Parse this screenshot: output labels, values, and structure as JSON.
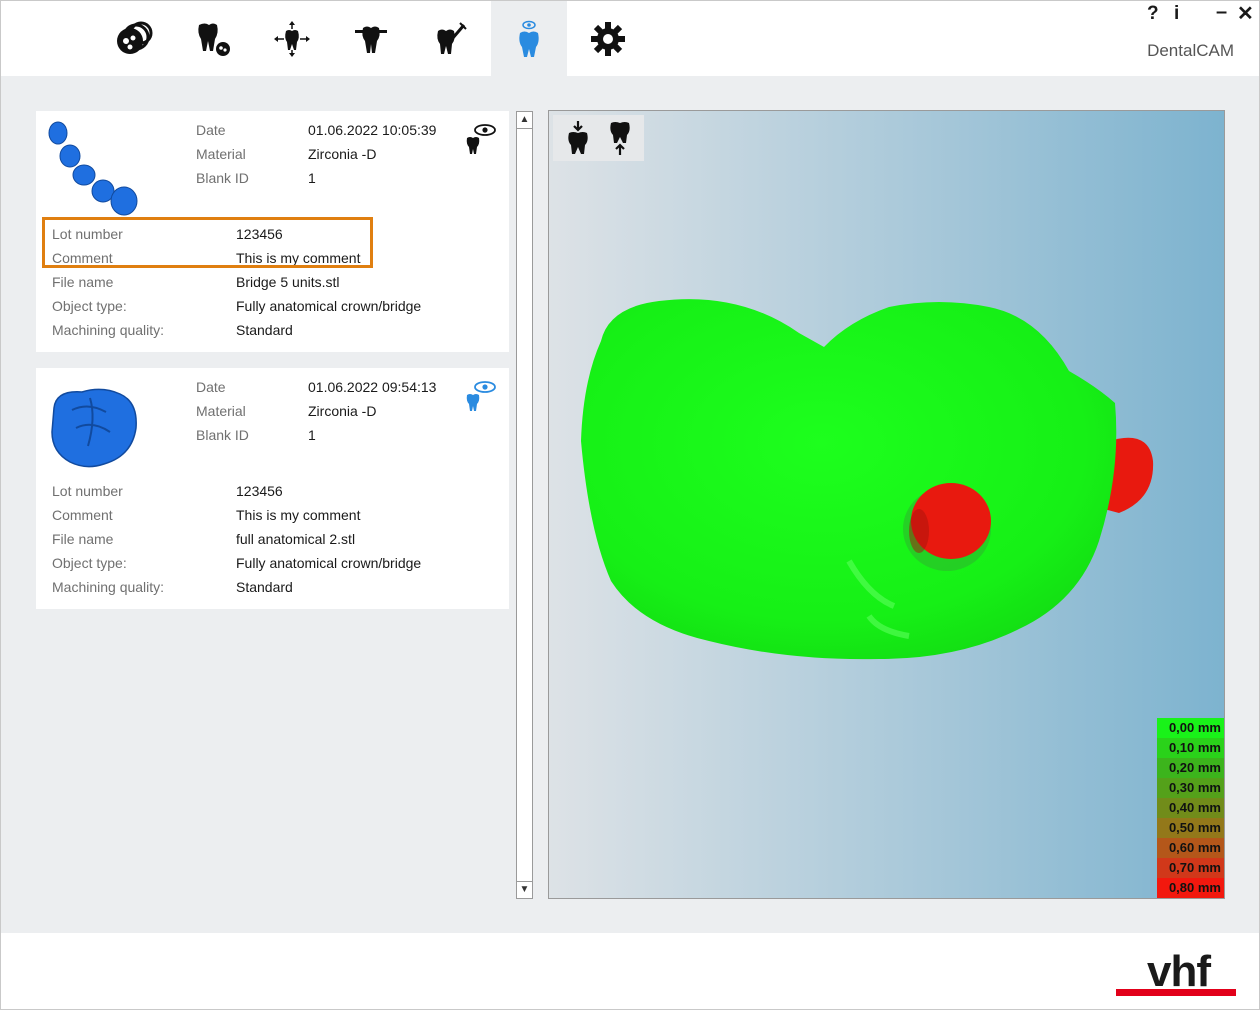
{
  "app": {
    "title": "DentalCAM",
    "help": "?",
    "info": "i",
    "minimize": "–",
    "close": "✕"
  },
  "toolbar": [
    {
      "name": "blank-magazine-icon"
    },
    {
      "name": "tooth-blank-icon"
    },
    {
      "name": "tooth-positioning-icon"
    },
    {
      "name": "tooth-holder-icon"
    },
    {
      "name": "tooth-tool-icon"
    },
    {
      "name": "tooth-preview-icon",
      "active": true
    },
    {
      "name": "settings-gear-icon"
    }
  ],
  "cards": [
    {
      "date_label": "Date",
      "date": "01.06.2022 10:05:39",
      "material_label": "Material",
      "material": "Zirconia -D",
      "blank_label": "Blank ID",
      "blank": "1",
      "lot_label": "Lot number",
      "lot": "123456",
      "comment_label": "Comment",
      "comment": "This is my comment",
      "file_label": "File name",
      "file": "Bridge 5 units.stl",
      "type_label": "Object type:",
      "type": "Fully anatomical crown/bridge",
      "quality_label": "Machining quality:",
      "quality": "Standard",
      "eye_color": "#111111"
    },
    {
      "date_label": "Date",
      "date": "01.06.2022 09:54:13",
      "material_label": "Material",
      "material": "Zirconia -D",
      "blank_label": "Blank ID",
      "blank": "1",
      "lot_label": "Lot number",
      "lot": "123456",
      "comment_label": "Comment",
      "comment": "This is my comment",
      "file_label": "File name",
      "file": "full anatomical 2.stl",
      "type_label": "Object type:",
      "type": "Fully anatomical crown/bridge",
      "quality_label": "Machining quality:",
      "quality": "Standard",
      "eye_color": "#2a8be0"
    }
  ],
  "scroll": {
    "up": "▲",
    "down": "▼"
  },
  "viewer": {
    "tools": [
      {
        "name": "view-from-top-icon"
      },
      {
        "name": "view-from-bottom-icon"
      }
    ],
    "legend": [
      {
        "label": "0,00 mm",
        "color": "#19f219"
      },
      {
        "label": "0,10 mm",
        "color": "#2ad21a"
      },
      {
        "label": "0,20 mm",
        "color": "#3cb41c"
      },
      {
        "label": "0,30 mm",
        "color": "#54a11a"
      },
      {
        "label": "0,40 mm",
        "color": "#718c1a"
      },
      {
        "label": "0,50 mm",
        "color": "#93781a"
      },
      {
        "label": "0,60 mm",
        "color": "#b4571a"
      },
      {
        "label": "0,70 mm",
        "color": "#d1381a"
      },
      {
        "label": "0,80 mm",
        "color": "#f2180e"
      }
    ]
  },
  "brand": {
    "accent": "#e2001a",
    "highlight": "#e07f10"
  }
}
